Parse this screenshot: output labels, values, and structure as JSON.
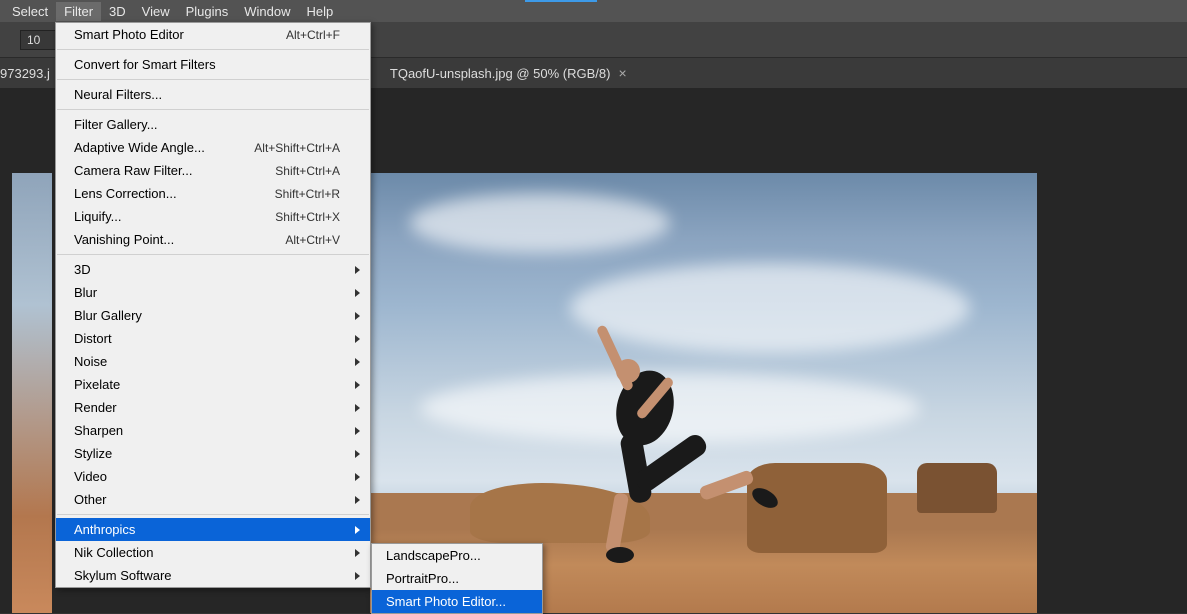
{
  "menubar": [
    "Select",
    "Filter",
    "3D",
    "View",
    "Plugins",
    "Window",
    "Help"
  ],
  "menubar_active_index": 1,
  "toolbar": {
    "field_value": "10"
  },
  "tabs": {
    "left_partial": "973293.j",
    "right": "TQaofU-unsplash.jpg @ 50% (RGB/8)"
  },
  "filter_menu": [
    {
      "type": "item",
      "label": "Smart Photo Editor",
      "shortcut": "Alt+Ctrl+F"
    },
    {
      "type": "sep"
    },
    {
      "type": "item",
      "label": "Convert for Smart Filters"
    },
    {
      "type": "sep"
    },
    {
      "type": "item",
      "label": "Neural Filters..."
    },
    {
      "type": "sep"
    },
    {
      "type": "item",
      "label": "Filter Gallery..."
    },
    {
      "type": "item",
      "label": "Adaptive Wide Angle...",
      "shortcut": "Alt+Shift+Ctrl+A"
    },
    {
      "type": "item",
      "label": "Camera Raw Filter...",
      "shortcut": "Shift+Ctrl+A"
    },
    {
      "type": "item",
      "label": "Lens Correction...",
      "shortcut": "Shift+Ctrl+R"
    },
    {
      "type": "item",
      "label": "Liquify...",
      "shortcut": "Shift+Ctrl+X"
    },
    {
      "type": "item",
      "label": "Vanishing Point...",
      "shortcut": "Alt+Ctrl+V"
    },
    {
      "type": "sep"
    },
    {
      "type": "item",
      "label": "3D",
      "submenu": true
    },
    {
      "type": "item",
      "label": "Blur",
      "submenu": true
    },
    {
      "type": "item",
      "label": "Blur Gallery",
      "submenu": true
    },
    {
      "type": "item",
      "label": "Distort",
      "submenu": true
    },
    {
      "type": "item",
      "label": "Noise",
      "submenu": true
    },
    {
      "type": "item",
      "label": "Pixelate",
      "submenu": true
    },
    {
      "type": "item",
      "label": "Render",
      "submenu": true
    },
    {
      "type": "item",
      "label": "Sharpen",
      "submenu": true
    },
    {
      "type": "item",
      "label": "Stylize",
      "submenu": true
    },
    {
      "type": "item",
      "label": "Video",
      "submenu": true
    },
    {
      "type": "item",
      "label": "Other",
      "submenu": true
    },
    {
      "type": "sep"
    },
    {
      "type": "item",
      "label": "Anthropics",
      "submenu": true,
      "highlighted": true
    },
    {
      "type": "item",
      "label": "Nik Collection",
      "submenu": true
    },
    {
      "type": "item",
      "label": "Skylum Software",
      "submenu": true
    }
  ],
  "anthropics_submenu": [
    {
      "label": "LandscapePro..."
    },
    {
      "label": "PortraitPro..."
    },
    {
      "label": "Smart Photo Editor...",
      "highlighted": true
    }
  ]
}
